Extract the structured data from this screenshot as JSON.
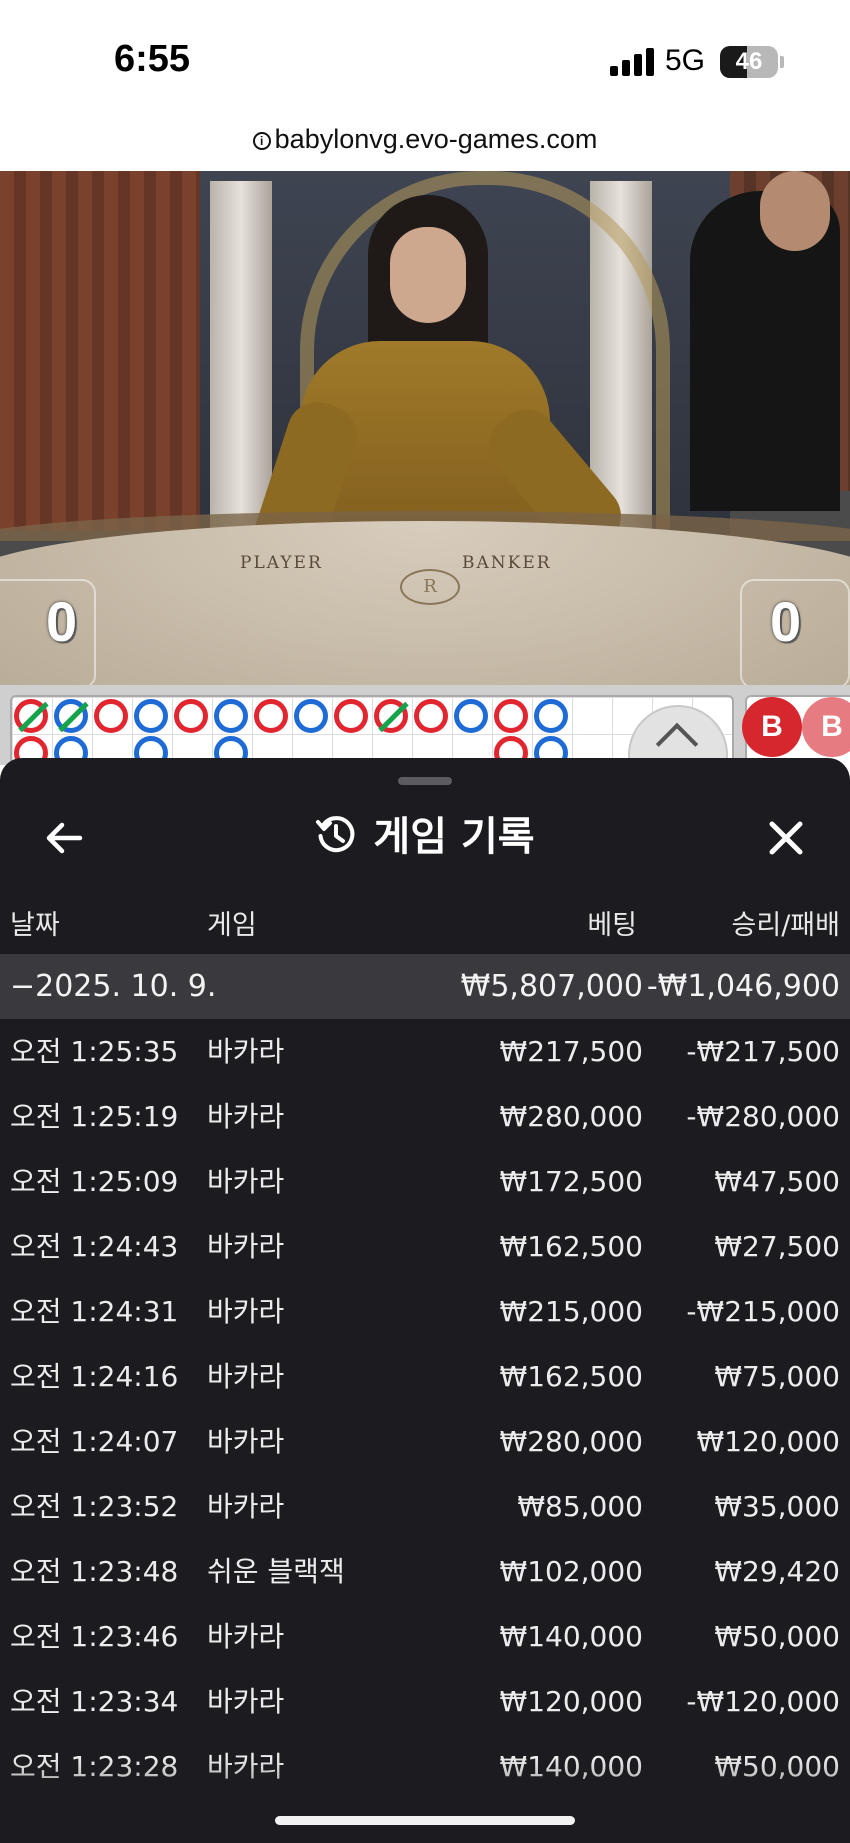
{
  "status_bar": {
    "time": "6:55",
    "network": "5G",
    "battery_text": "46",
    "battery_level": 0.46
  },
  "browser": {
    "url": "babylonvg.evo-games.com"
  },
  "video": {
    "player_label": "PLAYER",
    "banker_label": "BANKER",
    "player_score": "0",
    "banker_score": "0",
    "table_logo": "R"
  },
  "roadmap": {
    "badge_label": "B",
    "beads_row1": [
      "red-tie",
      "blue-tie",
      "red",
      "blue",
      "red",
      "blue",
      "red",
      "blue",
      "red",
      "red-tie",
      "red",
      "blue",
      "red",
      "blue"
    ],
    "beads_row2": [
      "red",
      "blue",
      "",
      "blue",
      "",
      "blue",
      "",
      "",
      "",
      "",
      "",
      "",
      "red",
      "blue"
    ]
  },
  "sheet": {
    "title": "게임 기록",
    "columns": {
      "date": "날짜",
      "game": "게임",
      "bet": "베팅",
      "result": "승리/패배"
    },
    "day": {
      "date": "−2025. 10. 9.",
      "bet": "₩5,807,000",
      "result": "-₩1,046,900"
    },
    "rows": [
      {
        "time": "오전 1:25:35",
        "game": "바카라",
        "bet": "₩217,500",
        "result": "-₩217,500"
      },
      {
        "time": "오전 1:25:19",
        "game": "바카라",
        "bet": "₩280,000",
        "result": "-₩280,000"
      },
      {
        "time": "오전 1:25:09",
        "game": "바카라",
        "bet": "₩172,500",
        "result": "₩47,500"
      },
      {
        "time": "오전 1:24:43",
        "game": "바카라",
        "bet": "₩162,500",
        "result": "₩27,500"
      },
      {
        "time": "오전 1:24:31",
        "game": "바카라",
        "bet": "₩215,000",
        "result": "-₩215,000"
      },
      {
        "time": "오전 1:24:16",
        "game": "바카라",
        "bet": "₩162,500",
        "result": "₩75,000"
      },
      {
        "time": "오전 1:24:07",
        "game": "바카라",
        "bet": "₩280,000",
        "result": "₩120,000"
      },
      {
        "time": "오전 1:23:52",
        "game": "바카라",
        "bet": "₩85,000",
        "result": "₩35,000"
      },
      {
        "time": "오전 1:23:48",
        "game": "쉬운 블랙잭",
        "bet": "₩102,000",
        "result": "₩29,420"
      },
      {
        "time": "오전 1:23:46",
        "game": "바카라",
        "bet": "₩140,000",
        "result": "₩50,000"
      },
      {
        "time": "오전 1:23:34",
        "game": "바카라",
        "bet": "₩120,000",
        "result": "-₩120,000"
      },
      {
        "time": "오전 1:23:28",
        "game": "바카라",
        "bet": "₩140,000",
        "result": "₩50,000"
      }
    ]
  },
  "colors": {
    "sheet_bg": "#1c1b1f",
    "day_row_bg": "#3a393d",
    "bead_red": "#e1262f",
    "bead_blue": "#1f6bd6",
    "bead_tie": "#13a34a"
  },
  "icons": {
    "back": "arrow-left-icon",
    "title": "history-icon",
    "close": "close-icon",
    "roadmap_toggle": "chevron-up-icon",
    "url_info": "info-icon"
  }
}
